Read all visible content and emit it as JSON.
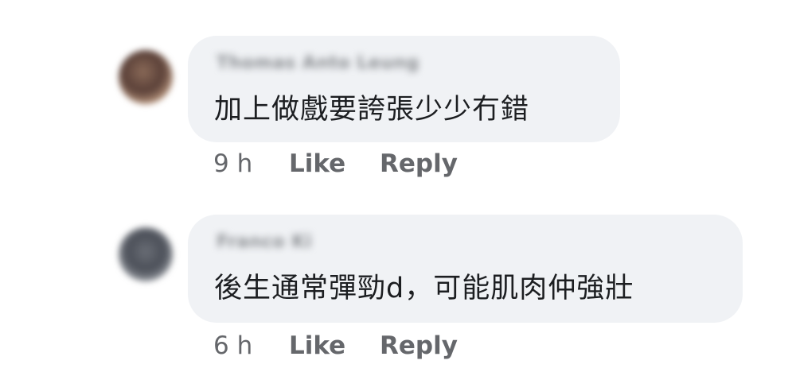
{
  "comments": [
    {
      "author": "Thomas Anto Leung",
      "text": "加上做戲要誇張少少冇錯",
      "time": "9 h",
      "like_label": "Like",
      "reply_label": "Reply"
    },
    {
      "author": "Franco Ki",
      "text": "後生通常彈勁d，可能肌肉仲強壯",
      "time": "6 h",
      "like_label": "Like",
      "reply_label": "Reply"
    }
  ],
  "colors": {
    "bubble_bg": "#f0f2f5",
    "text": "#1c1e21",
    "meta": "#65676b"
  }
}
